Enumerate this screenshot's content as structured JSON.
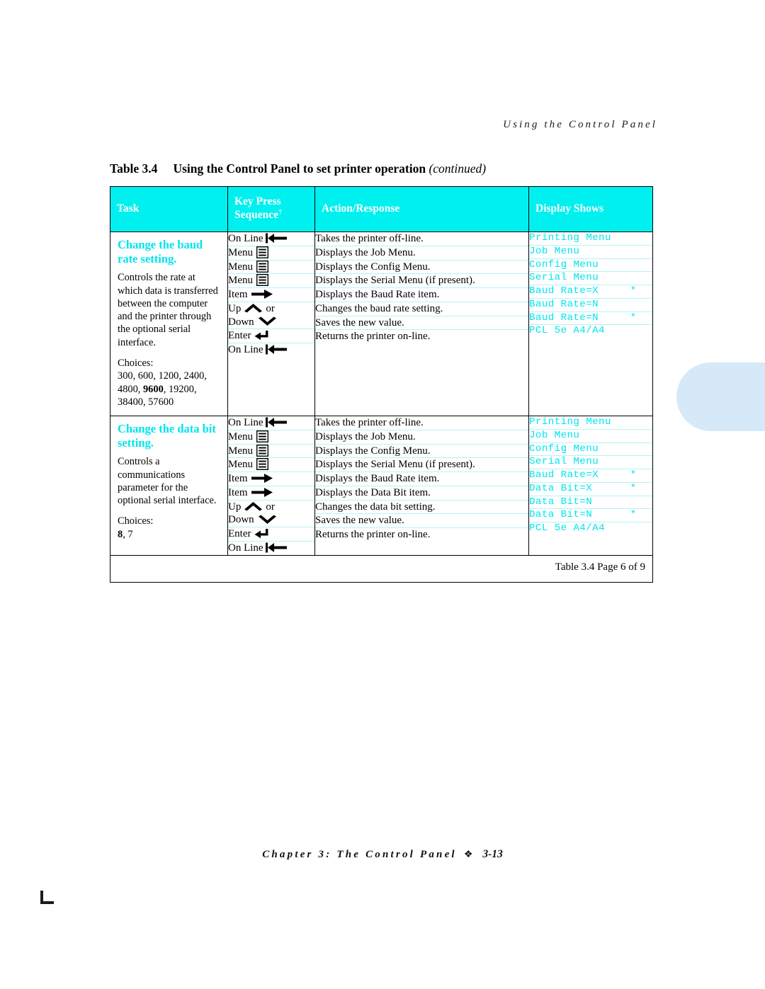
{
  "running_head": "Using the Control Panel",
  "table_caption": {
    "number": "Table 3.4",
    "title": "Using the Control Panel to set printer operation",
    "continued": "(continued)"
  },
  "colors": {
    "header_bg": "#00f0f0",
    "header_text": "#ffffff",
    "task_title": "#00e5ee",
    "display_text": "#00e5ee",
    "row_rule": "#b6f3f7",
    "side_tab": "#d6e9f8",
    "border": "#000000"
  },
  "columns": [
    {
      "label": "Task"
    },
    {
      "label": "Key Press",
      "label2": "Sequence",
      "dagger": "†"
    },
    {
      "label": "Action/Response"
    },
    {
      "label": "Display Shows"
    }
  ],
  "blocks": [
    {
      "task_title": "Change the baud rate setting.",
      "task_desc": "Controls the rate at which data is transferred between the computer and the printer through the optional serial interface.",
      "choices_label": "Choices:",
      "choices_before": "300, 600, 1200, 2400, 4800, ",
      "choices_default": "9600",
      "choices_after": ", 19200, 38400, 57600",
      "steps": [
        {
          "key": "On Line",
          "icon": "on-line-key-icon",
          "action": "Takes the printer off-line.",
          "display": "Printing Menu"
        },
        {
          "key": "Menu",
          "icon": "menu-key-icon",
          "action": "Displays the Job Menu.",
          "display": "Job Menu"
        },
        {
          "key": "Menu",
          "icon": "menu-key-icon",
          "action": "Displays the Config Menu.",
          "display": "Config Menu"
        },
        {
          "key": "Menu",
          "icon": "menu-key-icon",
          "action": "Displays the Serial Menu (if present).",
          "display": "Serial Menu"
        },
        {
          "key": "Item",
          "icon": "item-key-icon",
          "action": "Displays the Baud Rate item.",
          "display": "Baud Rate=X     *"
        },
        {
          "key": "Up",
          "key2": "or",
          "key3": "Down",
          "icon": "up-down-key-icon",
          "action": "Changes the baud rate setting.",
          "display": "Baud Rate=N"
        },
        {
          "key": "Enter",
          "icon": "enter-key-icon",
          "action": "Saves the new value.",
          "display": "Baud Rate=N     *"
        },
        {
          "key": "On Line",
          "icon": "on-line-key-icon",
          "action": "Returns the printer on-line.",
          "display": "PCL 5e A4/A4"
        }
      ]
    },
    {
      "task_title": "Change the data bit setting.",
      "task_desc": "Controls a communications parameter for the optional serial interface.",
      "choices_label": "Choices:",
      "choices_before": "",
      "choices_default": "8",
      "choices_after": ", 7",
      "steps": [
        {
          "key": "On Line",
          "icon": "on-line-key-icon",
          "action": "Takes the printer off-line.",
          "display": "Printing Menu"
        },
        {
          "key": "Menu",
          "icon": "menu-key-icon",
          "action": "Displays the Job Menu.",
          "display": "Job Menu"
        },
        {
          "key": "Menu",
          "icon": "menu-key-icon",
          "action": "Displays the Config Menu.",
          "display": "Config Menu"
        },
        {
          "key": "Menu",
          "icon": "menu-key-icon",
          "action": "Displays the Serial Menu (if present).",
          "display": "Serial Menu"
        },
        {
          "key": "Item",
          "icon": "item-key-icon",
          "action": "Displays the Baud Rate item.",
          "display": "Baud Rate=X     *"
        },
        {
          "key": "Item",
          "icon": "item-key-icon",
          "action": "Displays the Data Bit item.",
          "display": "Data Bit=X      *"
        },
        {
          "key": "Up",
          "key2": "or",
          "key3": "Down",
          "icon": "up-down-key-icon",
          "action": "Changes the data bit setting.",
          "display": "Data Bit=N"
        },
        {
          "key": "Enter",
          "icon": "enter-key-icon",
          "action": "Saves the new value.",
          "display": "Data Bit=N      *"
        },
        {
          "key": "On Line",
          "icon": "on-line-key-icon",
          "action": "Returns the printer on-line.",
          "display": "PCL 5e A4/A4"
        }
      ]
    }
  ],
  "table_footer": "Table 3.4  Page 6 of 9",
  "page_footer": {
    "chapter": "Chapter 3: The Control Panel",
    "diamond": "❖",
    "page_number": "3-13"
  }
}
